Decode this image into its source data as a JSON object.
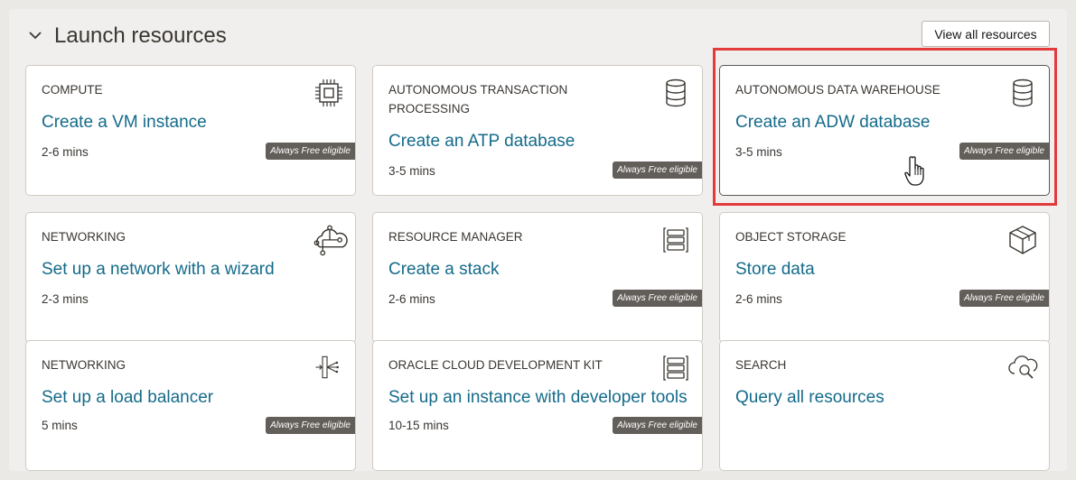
{
  "section": {
    "title": "Launch resources",
    "view_all_label": "View all resources"
  },
  "cards": [
    {
      "category": "COMPUTE",
      "link": "Create a VM instance",
      "time": "2-6 mins",
      "badge": "Always Free eligible",
      "icon": "cpu-chip-icon"
    },
    {
      "category": "AUTONOMOUS TRANSACTION PROCESSING",
      "link": "Create an ATP database",
      "time": "3-5 mins",
      "badge": "Always Free eligible",
      "icon": "database-icon"
    },
    {
      "category": "AUTONOMOUS DATA WAREHOUSE",
      "link": "Create an ADW database",
      "time": "3-5 mins",
      "badge": "Always Free eligible",
      "icon": "database-icon"
    },
    {
      "category": "NETWORKING",
      "link": "Set up a network with a wizard",
      "time": "2-3 mins",
      "icon": "cloud-network-icon"
    },
    {
      "category": "RESOURCE MANAGER",
      "link": "Create a stack",
      "time": "2-6 mins",
      "badge": "Always Free eligible",
      "icon": "stack-icon"
    },
    {
      "category": "OBJECT STORAGE",
      "link": "Store data",
      "time": "2-6 mins",
      "badge": "Always Free eligible",
      "icon": "storage-box-icon"
    },
    {
      "category": "NETWORKING",
      "link": "Set up a load balancer",
      "time": "5 mins",
      "badge": "Always Free eligible",
      "icon": "load-balancer-icon"
    },
    {
      "category": "ORACLE CLOUD DEVELOPMENT KIT",
      "link": "Set up an instance with developer tools",
      "time": "10-15 mins",
      "badge": "Always Free eligible",
      "icon": "dev-kit-icon"
    },
    {
      "category": "SEARCH",
      "link": "Query all resources",
      "icon": "cloud-search-icon"
    }
  ]
}
